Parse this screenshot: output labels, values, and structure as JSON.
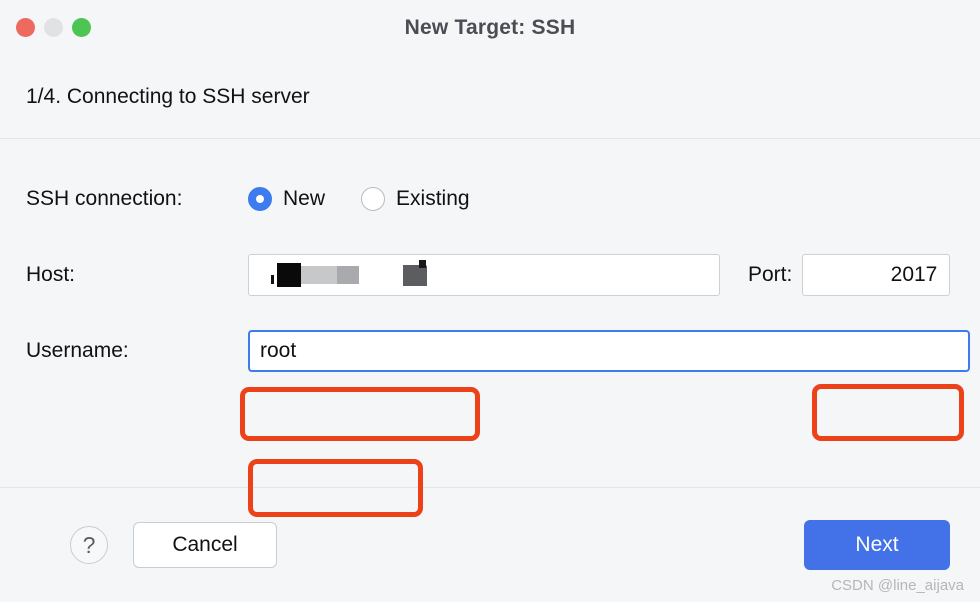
{
  "window": {
    "title": "New Target: SSH",
    "traffic_lights": [
      {
        "name": "close",
        "color": "#ee6a5f"
      },
      {
        "name": "minimize",
        "color": "#e1e2e3"
      },
      {
        "name": "maximize",
        "color": "#4cc553"
      }
    ]
  },
  "step": {
    "text": "1/4. Connecting to SSH server"
  },
  "form": {
    "connection": {
      "label": "SSH connection:",
      "selected": "New",
      "options": [
        {
          "label": "New",
          "selected": true
        },
        {
          "label": "Existing",
          "selected": false
        }
      ]
    },
    "host": {
      "label": "Host:",
      "value": "",
      "redacted": true
    },
    "port": {
      "label": "Port:",
      "value": "2017"
    },
    "username": {
      "label": "Username:",
      "value": "root",
      "focused": true
    }
  },
  "footer": {
    "help_label": "?",
    "cancel_label": "Cancel",
    "next_label": "Next"
  },
  "watermark": {
    "text": "CSDN @line_aijava"
  },
  "colors": {
    "accent": "#4271e8",
    "radio_selected": "#3d7bef",
    "annotation": "#ec4119",
    "focus_border": "#3d7bef",
    "window_bg": "#f5f6f8"
  }
}
